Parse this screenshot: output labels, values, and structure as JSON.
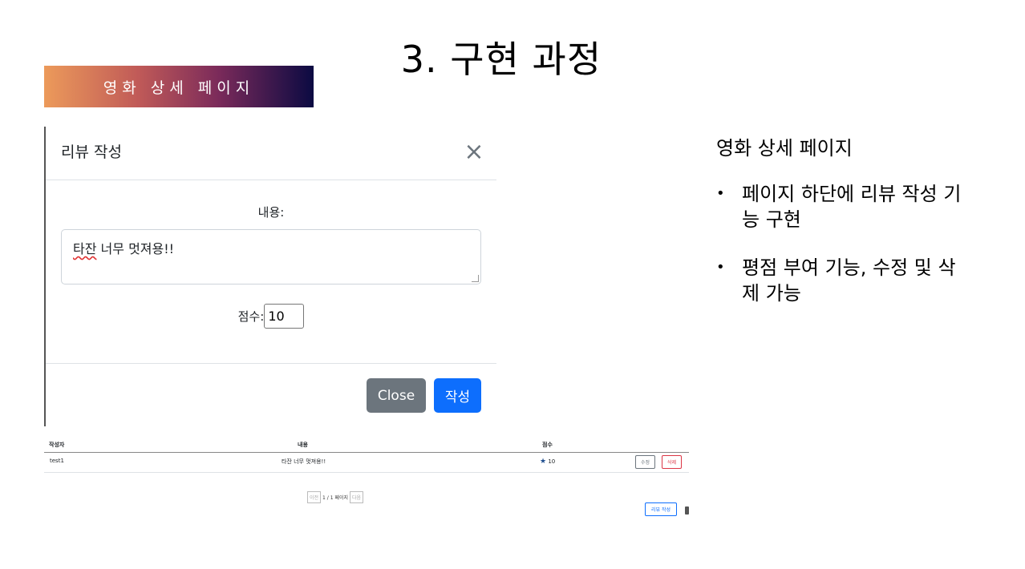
{
  "slide": {
    "title": "3. 구현 과정",
    "banner": "영화 상세 페이지",
    "side_heading": "영화 상세 페이지",
    "bullets": [
      "페이지 하단에 리뷰 작성 기능 구현",
      "평점 부여 기능, 수정 및 삭제 가능"
    ]
  },
  "modal": {
    "title": "리뷰 작성",
    "close_icon": "×",
    "content_label": "내용:",
    "content_value": "타잔 너무 멋져용!!",
    "content_misspelled": "타잔",
    "content_rest": " 너무 멋져용!!",
    "score_label": "점수:",
    "score_value": "10",
    "close_button": "Close",
    "submit_button": "작성"
  },
  "review_table": {
    "columns": [
      "작성자",
      "내용",
      "점수"
    ],
    "rows": [
      {
        "author": "test1",
        "content": "타잔 너무 멋져용!!",
        "score": "10",
        "edit": "수정",
        "delete": "삭제"
      }
    ],
    "pager": {
      "prev": "이전",
      "status": "1 / 1 페이지",
      "next": "다음"
    },
    "write_button": "리뷰 작성",
    "star_icon": "★"
  }
}
